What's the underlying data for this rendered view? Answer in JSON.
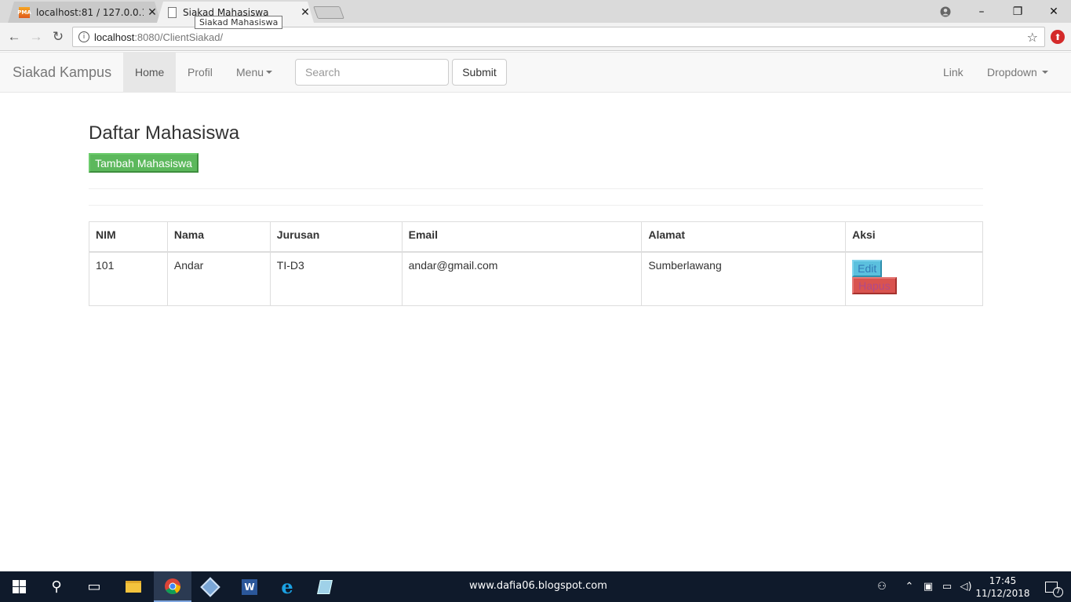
{
  "browser": {
    "tabs": [
      {
        "label": "localhost:81 / 127.0.0.1 /",
        "close": "✕"
      },
      {
        "label": "Siakad Mahasiswa",
        "close": "✕"
      }
    ],
    "tooltip": "Siakad Mahasiswa",
    "url_host": "localhost",
    "url_path": ":8080/ClientSiakad/",
    "window_controls": {
      "minimize": "–",
      "restore": "❐",
      "close": "✕"
    }
  },
  "navbar": {
    "brand": "Siakad Kampus",
    "items": [
      {
        "label": "Home"
      },
      {
        "label": "Profil"
      },
      {
        "label": "Menu"
      }
    ],
    "search": {
      "placeholder": "Search",
      "value": ""
    },
    "submit_label": "Submit",
    "right_items": [
      {
        "label": "Link"
      },
      {
        "label": "Dropdown"
      }
    ]
  },
  "main": {
    "title": "Daftar Mahasiswa",
    "add_button": "Tambah Mahasiswa",
    "table": {
      "headers": [
        "NIM",
        "Nama",
        "Jurusan",
        "Email",
        "Alamat",
        "Aksi"
      ],
      "rows": [
        {
          "nim": "101",
          "nama": "Andar",
          "jurusan": "TI-D3",
          "email": "andar@gmail.com",
          "alamat": "Sumberlawang",
          "edit": "Edit",
          "hapus": "Hapus"
        }
      ]
    }
  },
  "taskbar": {
    "watermark": "www.dafia06.blogspot.com",
    "time": "17:45",
    "date": "11/12/2018",
    "notification_count": "7"
  },
  "colors": {
    "success": "#5cb85c",
    "info": "#5bc0de",
    "danger": "#d9534f",
    "navbar_bg": "#f8f8f8",
    "taskbar_bg": "#0f1a2b"
  }
}
